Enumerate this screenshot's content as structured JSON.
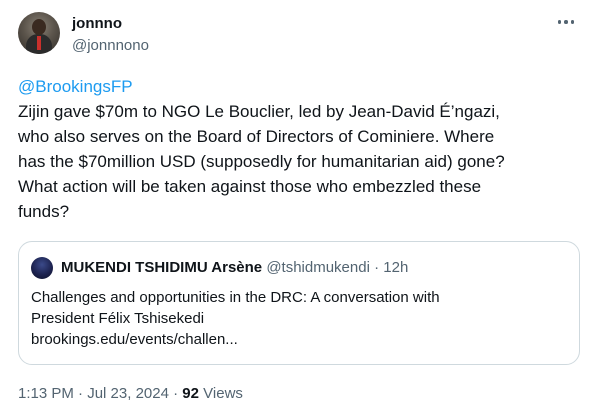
{
  "author": {
    "name": "jonnno",
    "handle": "@jonnnono"
  },
  "tweet": {
    "mention": "@BrookingsFP",
    "text": "Zijin gave $70m to NGO Le  Bouclier, led by Jean-David É’ngazi,\nwho also serves on the Board of Directors of Cominiere. Where\nhas the $70million USD (supposedly for humanitarian aid) gone?\nWhat action will be taken against those who embezzled these\nfunds?"
  },
  "quoted": {
    "name": "MUKENDI TSHIDIMU Arsène",
    "handle": "@tshidmukendi",
    "separator": "·",
    "time": "12h",
    "text": "Challenges and opportunities in the DRC: A conversation with\nPresident Félix Tshisekedi\nbrookings.edu/events/challen..."
  },
  "footer": {
    "time": "1:13 PM",
    "separator1": "·",
    "date": "Jul 23, 2024",
    "separator2": "·",
    "views_count": "92",
    "views_label": "Views"
  },
  "icons": {
    "more": "more-horizontal-icon"
  }
}
